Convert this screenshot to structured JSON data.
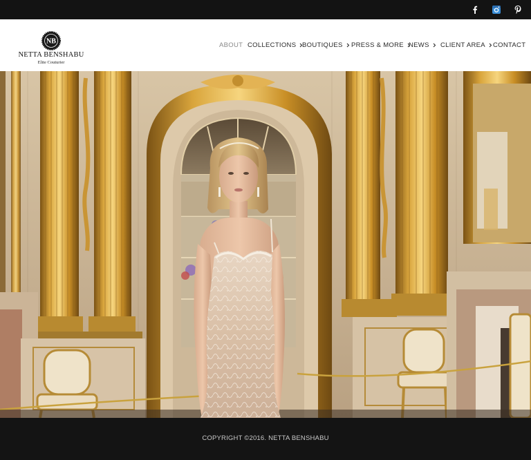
{
  "social": {
    "facebook": "facebook-icon",
    "instagram": "instagram-icon",
    "pinterest": "pinterest-icon",
    "instagram_color": "#3b8fd9"
  },
  "brand": {
    "monogram": "NB",
    "name": "NETTA BENSHABU",
    "tagline": "Elite Couturier"
  },
  "nav": {
    "items": [
      {
        "label": "ABOUT",
        "active": true,
        "has_submenu": false
      },
      {
        "label": "COLLECTIONS",
        "active": false,
        "has_submenu": true
      },
      {
        "label": "BOUTIQUES",
        "active": false,
        "has_submenu": true
      },
      {
        "label": "PRESS & MORE",
        "active": false,
        "has_submenu": true
      },
      {
        "label": "NEWS",
        "active": false,
        "has_submenu": true
      },
      {
        "label": "CLIENT AREA",
        "active": false,
        "has_submenu": true
      },
      {
        "label": "CONTACT",
        "active": false,
        "has_submenu": false
      }
    ]
  },
  "hero": {
    "image": "bride-in-lace-gown-in-gilded-palace-hall"
  },
  "footer": {
    "copyright": "COPYRIGHT ©2016. NETTA BENSHABU"
  },
  "colors": {
    "topbar": "#131313",
    "footer": "#141414",
    "nav_text": "#2a2a2a",
    "nav_active": "#8a8a8a",
    "gold": "#c9962e"
  }
}
